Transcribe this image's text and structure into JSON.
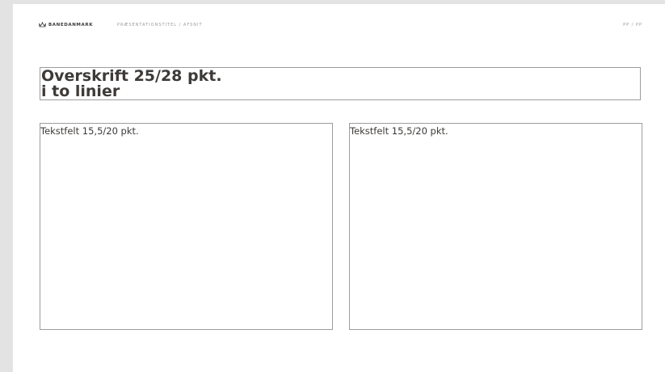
{
  "header": {
    "logo_text": "BANEDANMARK",
    "presentation_title": "PRÆSENTATIONSTITEL / AFSNIT",
    "page_number": "PP / PP"
  },
  "headline": {
    "line1": "Overskrift 25/28 pkt.",
    "line2": "i to linier"
  },
  "text_fields": [
    {
      "text": "Tekstfelt 15,5/20 pkt."
    },
    {
      "text": "Tekstfelt 15,5/20 pkt."
    }
  ],
  "icons": {
    "logo": "crown-icon"
  },
  "colors": {
    "canvas_background": "#e3e3e3",
    "slide_background": "#ffffff",
    "text": "#3d3a38",
    "muted_text": "#9a9a9a",
    "box_border": "#9d9d9d"
  }
}
